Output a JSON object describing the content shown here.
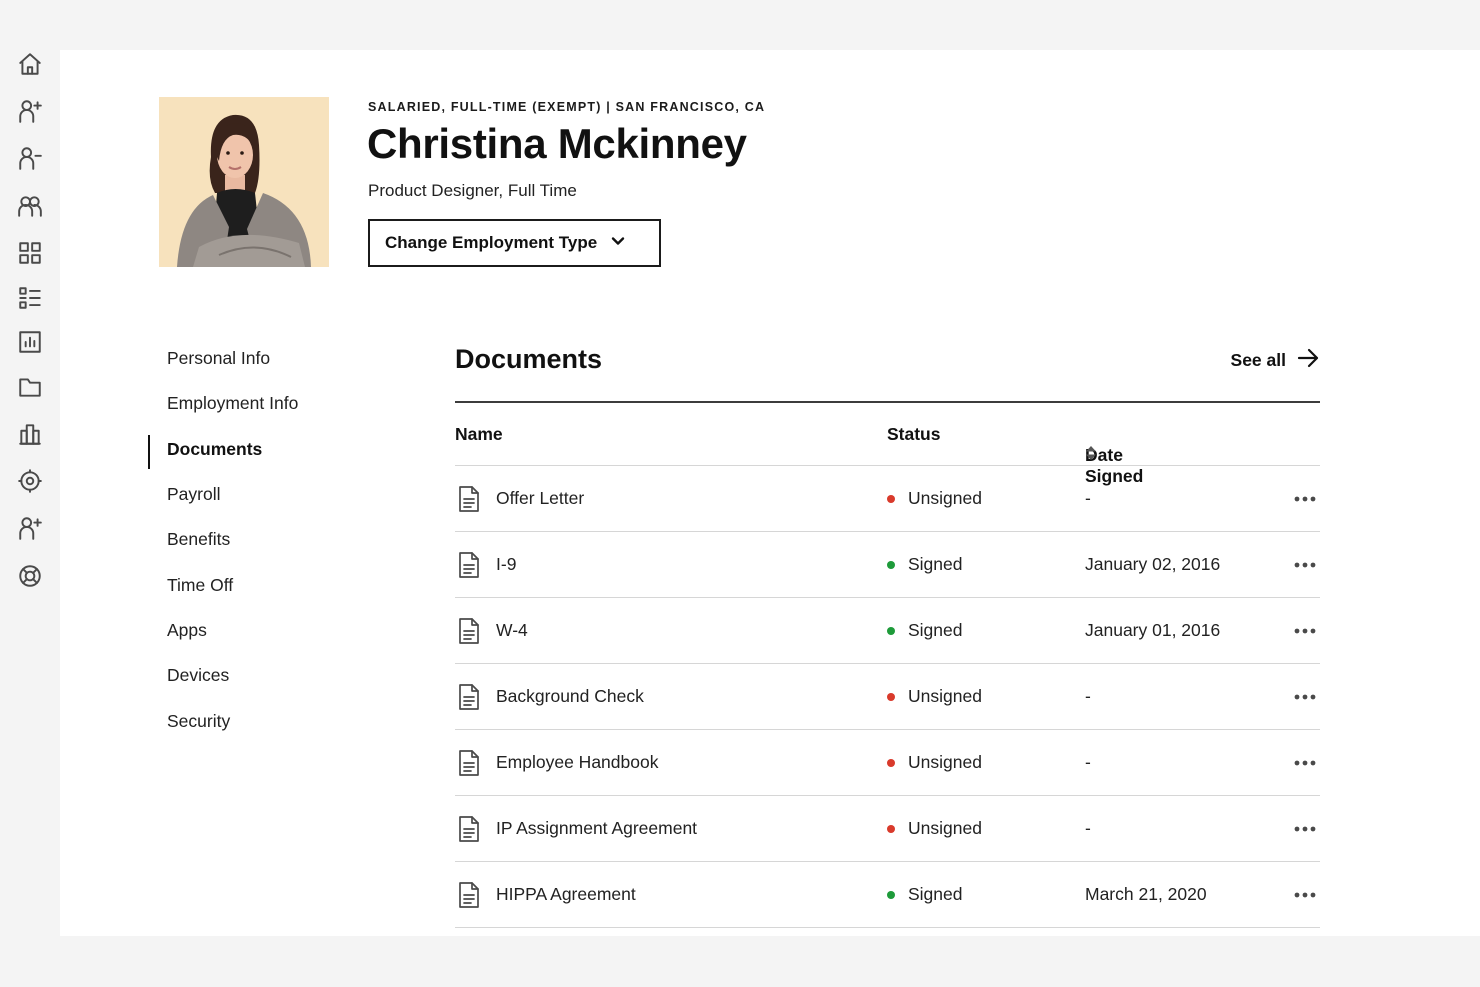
{
  "rail": {
    "icons": [
      "home-icon",
      "add-person-icon",
      "remove-person-icon",
      "people-icon",
      "apps-grid-icon",
      "list-icon",
      "report-icon",
      "folder-icon",
      "buildings-icon",
      "settings-icon",
      "invite-person-icon",
      "help-lifebuoy-icon"
    ]
  },
  "profile": {
    "meta": "SALARIED, FULL-TIME (EXEMPT) | SAN FRANCISCO, CA",
    "name": "Christina Mckinney",
    "role": "Product Designer, Full Time",
    "change_button": "Change Employment Type",
    "photo_background": "#f7e2bd"
  },
  "subnav": {
    "items": [
      {
        "label": "Personal Info",
        "active": false
      },
      {
        "label": "Employment Info",
        "active": false
      },
      {
        "label": "Documents",
        "active": true
      },
      {
        "label": "Payroll",
        "active": false
      },
      {
        "label": "Benefits",
        "active": false
      },
      {
        "label": "Time Off",
        "active": false
      },
      {
        "label": "Apps",
        "active": false
      },
      {
        "label": "Devices",
        "active": false
      },
      {
        "label": "Security",
        "active": false
      }
    ]
  },
  "documents": {
    "title": "Documents",
    "see_all": "See all",
    "columns": {
      "name": "Name",
      "status": "Status",
      "date": "Date Signed"
    },
    "rows": [
      {
        "name": "Offer Letter",
        "status": "Unsigned",
        "date": "-"
      },
      {
        "name": "I-9",
        "status": "Signed",
        "date": "January 02, 2016"
      },
      {
        "name": "W-4",
        "status": "Signed",
        "date": "January 01, 2016"
      },
      {
        "name": "Background Check",
        "status": "Unsigned",
        "date": "-"
      },
      {
        "name": "Employee Handbook",
        "status": "Unsigned",
        "date": "-"
      },
      {
        "name": "IP Assignment Agreement",
        "status": "Unsigned",
        "date": "-"
      },
      {
        "name": "HIPPA Agreement",
        "status": "Signed",
        "date": "March 21, 2020"
      }
    ]
  },
  "colors": {
    "signed": "#1e9b3a",
    "unsigned": "#d93a2b",
    "panel": "#ffffff",
    "background": "#f4f4f4"
  }
}
